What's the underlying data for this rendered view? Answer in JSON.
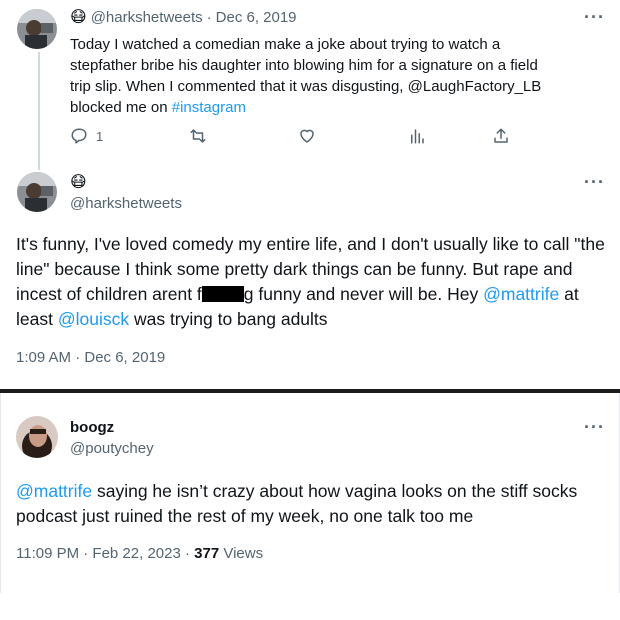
{
  "tweet1": {
    "emoji": "😷",
    "handle": "@harkshetweets",
    "sep": "·",
    "date": "Dec 6, 2019",
    "text_before": "Today I watched a comedian make a joke about trying to watch a stepfather bribe his daughter into blowing him for a signature on a field trip slip. When I commented that it was disgusting, @LaughFactory_LB blocked me on ",
    "hashtag": "#instagram",
    "reply_count": "1",
    "icons": [
      "reply-icon",
      "retweet-icon",
      "like-icon",
      "views-icon",
      "share-icon"
    ]
  },
  "tweet2": {
    "emoji": "😷",
    "handle": "@harkshetweets",
    "text_part1": "It's funny, I've loved comedy my entire life, and I don't usually like to call \"the line\" because I think some pretty dark things can be funny. But rape and incest of children arent f",
    "text_part2": "g funny and never will be. Hey ",
    "mention1": "@mattrife",
    "text_part3": " at least ",
    "mention2": "@louisck",
    "text_part4": " was trying to bang adults",
    "timestamp": "1:09 AM · Dec 6, 2019"
  },
  "tweet3": {
    "name": "boogz",
    "handle": "@poutychey",
    "mention": "@mattrife",
    "text": " saying he isn’t crazy about how vagina looks on the stiff socks podcast just ruined the rest of my week, no one talk too me",
    "timestamp": "11:09 PM · Feb 22, 2023 · ",
    "views_count": "377",
    "views_label": " Views"
  },
  "colors": {
    "link": "#1d9bf0",
    "muted": "#536471",
    "text": "#0f1419"
  }
}
